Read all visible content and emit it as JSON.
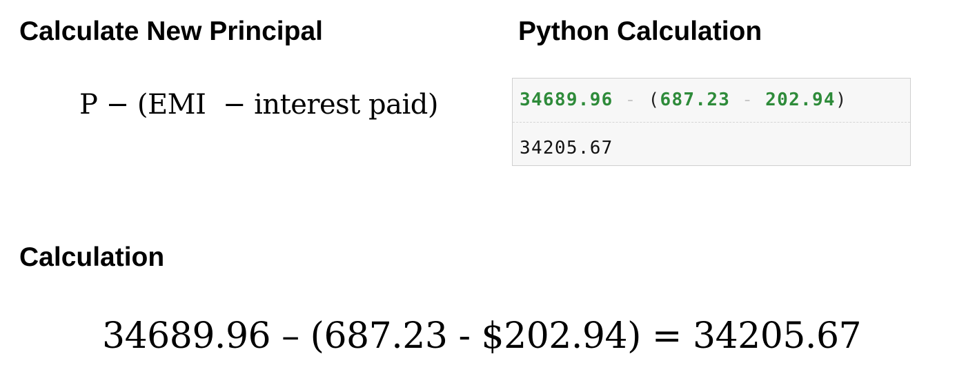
{
  "headings": {
    "left": "Calculate New Principal",
    "right": "Python Calculation",
    "calculation": "Calculation"
  },
  "formula": "P − (EMI  − interest paid)",
  "python": {
    "input": {
      "a": "34689.96",
      "op1": "-",
      "lparen": "(",
      "b": "687.23",
      "op2": "-",
      "c": "202.94",
      "rparen": ")"
    },
    "output": "34205.67"
  },
  "calculation_line": "34689.96 – (687.23 - $202.94) = 34205.67",
  "colors": {
    "code_number": "#2e8b3a",
    "code_operator": "#c8c8c8",
    "code_background": "#f7f7f7"
  }
}
